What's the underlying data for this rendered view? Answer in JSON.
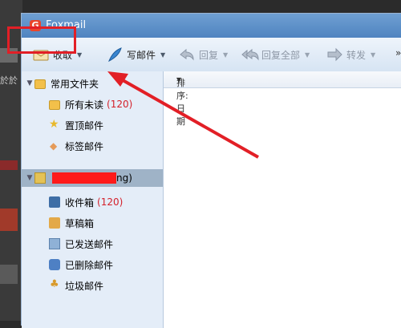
{
  "window": {
    "title": "Foxmail"
  },
  "background": {
    "side_text": "於於"
  },
  "toolbar": {
    "receive_label": "收取",
    "compose_label": "写邮件",
    "reply_label": "回复",
    "reply_all_label": "回复全部",
    "forward_label": "转发",
    "more_label": "»"
  },
  "sidebar": {
    "common_folder": "常用文件夹",
    "common_items": [
      {
        "label": "所有未读",
        "count": "(120)"
      },
      {
        "label": "置顶邮件"
      },
      {
        "label": "标签邮件"
      }
    ],
    "account_suffix": "ng)",
    "account_items": [
      {
        "label": "收件箱",
        "count": "(120)"
      },
      {
        "label": "草稿箱"
      },
      {
        "label": "已发送邮件"
      },
      {
        "label": "已删除邮件"
      },
      {
        "label": "垃圾邮件"
      }
    ]
  },
  "list": {
    "sort_label": "排序:日期"
  },
  "colors": {
    "highlight": "#e21f26",
    "titlebar": "#5a8fca",
    "unread_count": "#d4202a"
  }
}
